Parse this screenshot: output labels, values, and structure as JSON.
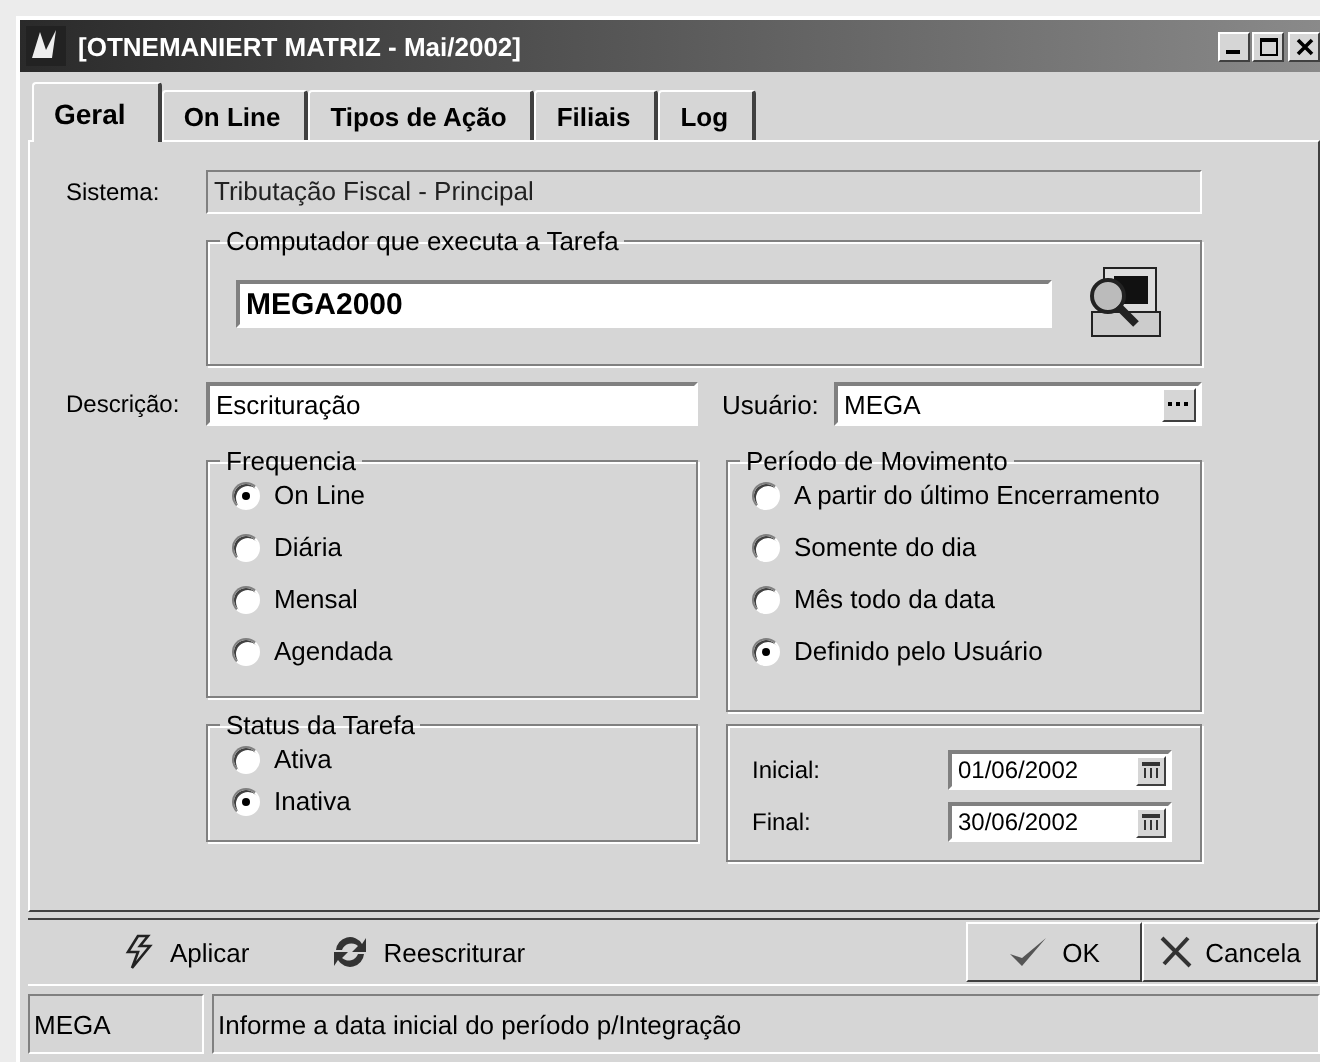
{
  "window": {
    "title": "[OTNEMANIERT MATRIZ - Mai/2002]"
  },
  "tabs": [
    {
      "label": "Geral",
      "selected": true
    },
    {
      "label": "On Line",
      "selected": false
    },
    {
      "label": "Tipos de Ação",
      "selected": false
    },
    {
      "label": "Filiais",
      "selected": false
    },
    {
      "label": "Log",
      "selected": false
    }
  ],
  "sistema": {
    "label": "Sistema:",
    "value": "Tributação Fiscal - Principal",
    "disabled": true
  },
  "computador": {
    "title": "Computador que executa a Tarefa",
    "value": "MEGA2000"
  },
  "descricao": {
    "label": "Descrição:",
    "value": "Escrituração"
  },
  "usuario": {
    "label": "Usuário:",
    "value": "MEGA"
  },
  "frequencia": {
    "title": "Frequencia",
    "options": [
      {
        "label": "On Line",
        "selected": true
      },
      {
        "label": "Diária",
        "selected": false
      },
      {
        "label": "Mensal",
        "selected": false
      },
      {
        "label": "Agendada",
        "selected": false
      }
    ]
  },
  "status_tarefa": {
    "title": "Status da Tarefa",
    "options": [
      {
        "label": "Ativa",
        "selected": false
      },
      {
        "label": "Inativa",
        "selected": true
      }
    ]
  },
  "periodo": {
    "title": "Período de Movimento",
    "options": [
      {
        "label": "A partir do último Encerramento",
        "selected": false
      },
      {
        "label": "Somente do dia",
        "selected": false
      },
      {
        "label": "Mês todo da data",
        "selected": false
      },
      {
        "label": "Definido pelo Usuário",
        "selected": true
      }
    ]
  },
  "dates": [
    {
      "label": "Inicial:",
      "value": "01/06/2002"
    },
    {
      "label": "Final:",
      "value": "30/06/2002"
    }
  ],
  "buttons": [
    {
      "label": "Aplicar",
      "kind": "apply"
    },
    {
      "label": "Reescriturar",
      "kind": "refresh"
    },
    {
      "label": "OK",
      "kind": "confirm"
    },
    {
      "label": "Cancela",
      "kind": "cancel"
    }
  ],
  "status_bar": [
    "MEGA",
    "Informe a data inicial do período p/Integração"
  ]
}
